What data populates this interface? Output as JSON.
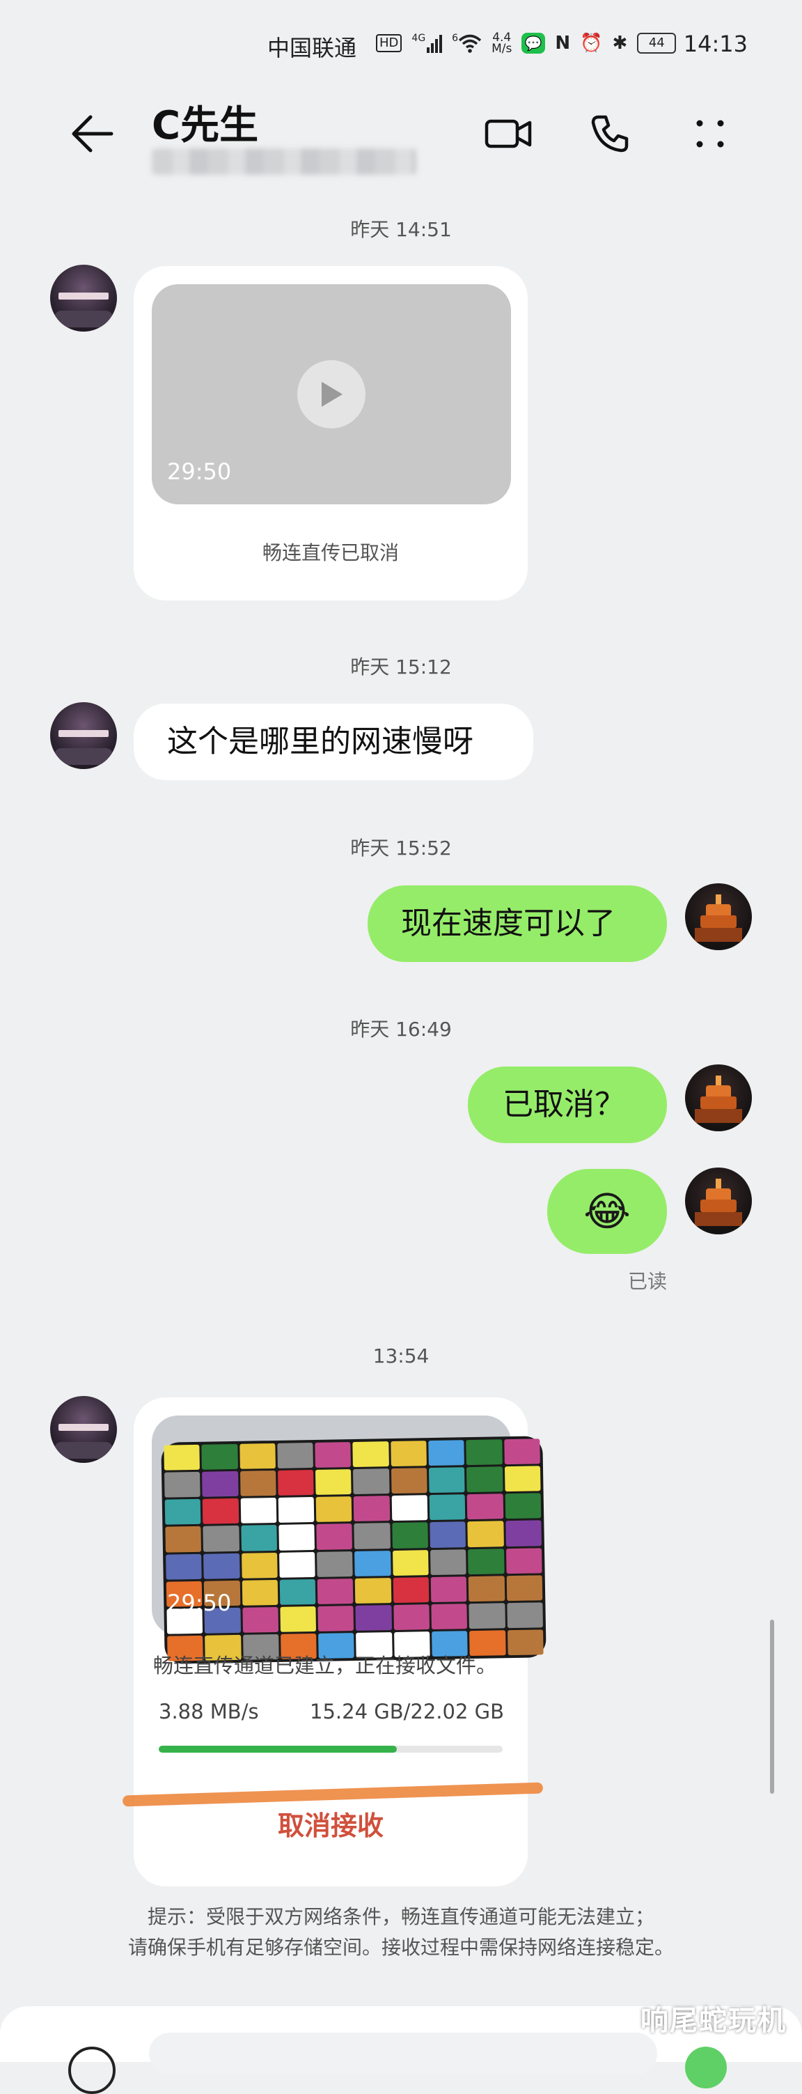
{
  "status_bar": {
    "carrier": "中国联通",
    "hd": "HD",
    "network": "4G",
    "wifi": "6",
    "speed_top": "4.4",
    "speed_bottom": "M/s",
    "nfc": "N",
    "battery": "44",
    "time": "14:13"
  },
  "header": {
    "title": "C先生",
    "icons": [
      "back-arrow-icon",
      "video-call-icon",
      "voice-call-icon",
      "more-icon"
    ]
  },
  "messages": {
    "ts1": "昨天 14:51",
    "video1": {
      "duration": "29:50",
      "status": "畅连直传已取消"
    },
    "ts2": "昨天 15:12",
    "msg1": "这个是哪里的网速慢呀",
    "ts3": "昨天 15:52",
    "msg2": "现在速度可以了",
    "ts4": "昨天 16:49",
    "msg3": "已取消？",
    "msg4_emoji": "😂",
    "read_status": "已读",
    "ts5": "13:54",
    "video2": {
      "duration": "29:50",
      "status": "畅连直传通道已建立，正在接收文件。",
      "speed": "3.88 MB/s",
      "progress_text": "15.24 GB/22.02 GB",
      "progress_fraction": 0.692,
      "cancel_label": "取消接收"
    }
  },
  "hint": {
    "line1": "提示：受限于双方网络条件，畅连直传通道可能无法建立；",
    "line2": "请确保手机有足够存储空间。接收过程中需保持网络连接稳定。"
  },
  "watermark": "响尾蛇玩机",
  "colors": {
    "background": "#eff0f1",
    "sent_bubble": "#95ec69",
    "received_bubble": "#ffffff",
    "progress": "#36b24a",
    "cancel": "#d0503c",
    "annotation_stroke": "#ee8a42"
  }
}
